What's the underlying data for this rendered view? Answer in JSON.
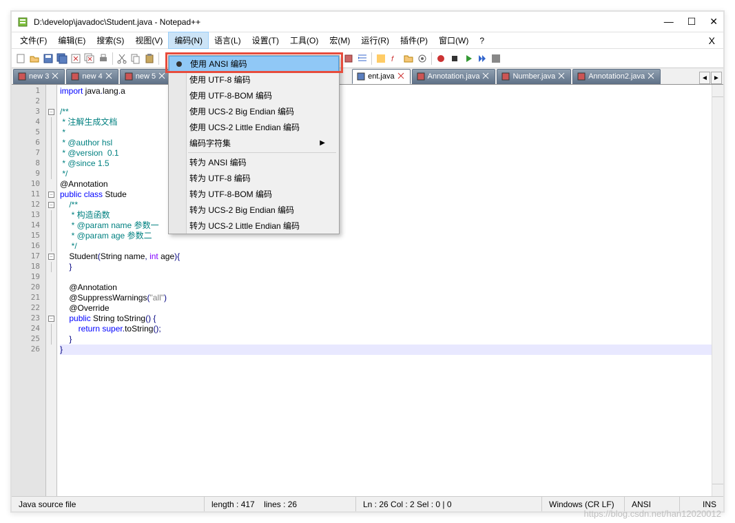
{
  "title": "D:\\develop\\javadoc\\Student.java - Notepad++",
  "menubar": {
    "items": [
      "文件(F)",
      "编辑(E)",
      "搜索(S)",
      "视图(V)",
      "编码(N)",
      "语言(L)",
      "设置(T)",
      "工具(O)",
      "宏(M)",
      "运行(R)",
      "插件(P)",
      "窗口(W)",
      "?"
    ],
    "active_index": 4
  },
  "tabs": [
    {
      "label": "new 3",
      "active": false,
      "dirty": true
    },
    {
      "label": "new 4",
      "active": false,
      "dirty": true
    },
    {
      "label": "new 5",
      "active": false,
      "dirty": true
    },
    {
      "label": "ent.java",
      "active": true,
      "dirty": true
    },
    {
      "label": "Annotation.java",
      "active": false,
      "dirty": true
    },
    {
      "label": "Number.java",
      "active": false,
      "dirty": true
    },
    {
      "label": "Annotation2.java",
      "active": false,
      "dirty": true
    }
  ],
  "dropdown": {
    "items_group1": [
      "使用 ANSI 编码",
      "使用 UTF-8 编码",
      "使用 UTF-8-BOM 编码",
      "使用 UCS-2 Big Endian 编码",
      "使用 UCS-2 Little Endian 编码"
    ],
    "submenu": "编码字符集",
    "items_group2": [
      "转为 ANSI 编码",
      "转为 UTF-8 编码",
      "转为 UTF-8-BOM 编码",
      "转为 UCS-2 Big Endian 编码",
      "转为 UCS-2 Little Endian 编码"
    ],
    "highlighted_index": 0
  },
  "code_lines": [
    {
      "n": 1,
      "html": "<span class='kw'>import</span> java<span class='op'>.</span>lang<span class='op'>.</span>a"
    },
    {
      "n": 2,
      "html": ""
    },
    {
      "n": 3,
      "html": "<span class='doc'>/**</span>",
      "fold": "open"
    },
    {
      "n": 4,
      "html": "<span class='doc'> * 注解生成文档</span>"
    },
    {
      "n": 5,
      "html": "<span class='doc'> *</span>"
    },
    {
      "n": 6,
      "html": "<span class='doc'> * @author hsl</span>"
    },
    {
      "n": 7,
      "html": "<span class='doc'> * @version  0.1</span>"
    },
    {
      "n": 8,
      "html": "<span class='doc'> * @since 1.5</span>"
    },
    {
      "n": 9,
      "html": "<span class='doc'> */</span>"
    },
    {
      "n": 10,
      "html": "<span class='ann'>@Annotation</span>"
    },
    {
      "n": 11,
      "html": "<span class='kw'>public</span> <span class='kw'>class</span> Stude",
      "fold": "open"
    },
    {
      "n": 12,
      "html": "    <span class='doc'>/**</span>",
      "fold": "open"
    },
    {
      "n": 13,
      "html": "    <span class='doc'> * 构造函数</span>"
    },
    {
      "n": 14,
      "html": "    <span class='doc'> * @param name 参数一</span>"
    },
    {
      "n": 15,
      "html": "    <span class='doc'> * @param age 参数二</span>"
    },
    {
      "n": 16,
      "html": "    <span class='doc'> */</span>"
    },
    {
      "n": 17,
      "html": "    Student<span class='op'>(</span>String name<span class='op'>,</span> <span class='type'>int</span> age<span class='op'>){</span>",
      "fold": "open"
    },
    {
      "n": 18,
      "html": "    <span class='op'>}</span>"
    },
    {
      "n": 19,
      "html": ""
    },
    {
      "n": 20,
      "html": "    <span class='ann'>@Annotation</span>"
    },
    {
      "n": 21,
      "html": "    <span class='ann'>@SuppressWarnings</span><span class='op'>(</span><span class='str'>\"all\"</span><span class='op'>)</span>"
    },
    {
      "n": 22,
      "html": "    <span class='ann'>@Override</span>"
    },
    {
      "n": 23,
      "html": "    <span class='kw'>public</span> String toString<span class='op'>()</span> <span class='op'>{</span>",
      "fold": "open"
    },
    {
      "n": 24,
      "html": "        <span class='kw'>return</span> <span class='kw'>super</span><span class='op'>.</span>toString<span class='op'>();</span>"
    },
    {
      "n": 25,
      "html": "    <span class='op'>}</span>"
    },
    {
      "n": 26,
      "html": "<span class='op'>}</span>",
      "current": true
    }
  ],
  "statusbar": {
    "filetype": "Java source file",
    "length": "length : 417",
    "lines": "lines : 26",
    "pos": "Ln : 26    Col : 2    Sel : 0 | 0",
    "eol": "Windows (CR LF)",
    "enc": "ANSI",
    "ins": "INS"
  },
  "watermark": "https://blog.csdn.net/han12020012"
}
